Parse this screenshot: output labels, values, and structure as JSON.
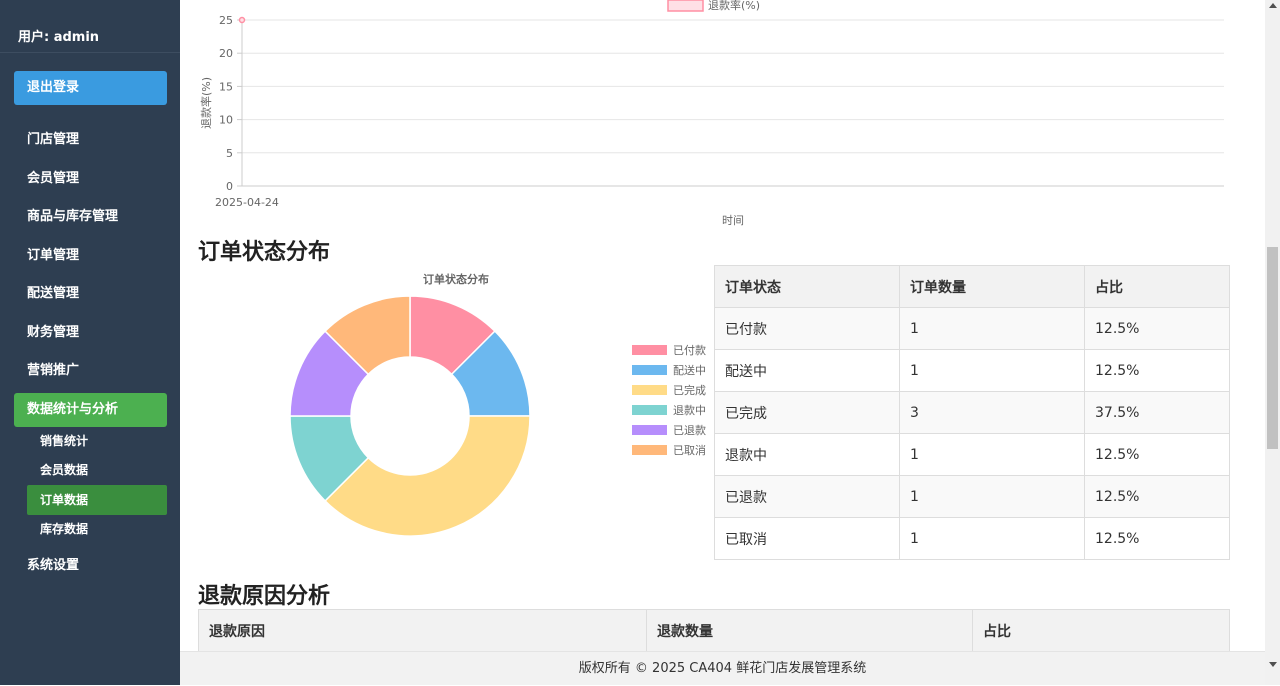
{
  "sidebar": {
    "user_label": "用户: admin",
    "logout_label": "退出登录",
    "items": [
      {
        "label": "门店管理"
      },
      {
        "label": "会员管理"
      },
      {
        "label": "商品与库存管理"
      },
      {
        "label": "订单管理"
      },
      {
        "label": "配送管理"
      },
      {
        "label": "财务管理"
      },
      {
        "label": "营销推广"
      },
      {
        "label": "数据统计与分析"
      },
      {
        "label": "系统设置"
      }
    ],
    "active_item": "数据统计与分析",
    "sub_items": [
      {
        "label": "销售统计"
      },
      {
        "label": "会员数据"
      },
      {
        "label": "订单数据"
      },
      {
        "label": "库存数据"
      }
    ],
    "active_sub_item": "订单数据",
    "colors": {
      "background": "#2e3e51",
      "logout": "#3a9be0",
      "active": "#4cb050",
      "active_sub": "#3a8e3e"
    }
  },
  "chart_data": [
    {
      "type": "line",
      "legend": "退款率(%)",
      "series": [
        {
          "name": "退款率(%)",
          "x": [
            "2025-04-24"
          ],
          "values": [
            25
          ]
        }
      ],
      "xlabel": "时间",
      "ylabel": "退款率(%)",
      "ylim": [
        0,
        25
      ],
      "yticks": [
        0,
        5,
        10,
        15,
        20,
        25
      ],
      "color": "#ff8fa3",
      "grid": true,
      "legend_position": "top"
    },
    {
      "type": "pie",
      "title": "订单状态分布",
      "categories": [
        "已付款",
        "配送中",
        "已完成",
        "退款中",
        "已退款",
        "已取消"
      ],
      "values": [
        1,
        1,
        3,
        1,
        1,
        1
      ],
      "colors": [
        "#ff8fa3",
        "#6cb8ef",
        "#ffdb87",
        "#7ed3d1",
        "#b68efc",
        "#ffb87a"
      ],
      "legend_position": "right"
    }
  ],
  "order_status_section": {
    "title": "订单状态分布",
    "headers": [
      "订单状态",
      "订单数量",
      "占比"
    ],
    "rows": [
      [
        "已付款",
        "1",
        "12.5%"
      ],
      [
        "配送中",
        "1",
        "12.5%"
      ],
      [
        "已完成",
        "3",
        "37.5%"
      ],
      [
        "退款中",
        "1",
        "12.5%"
      ],
      [
        "已退款",
        "1",
        "12.5%"
      ],
      [
        "已取消",
        "1",
        "12.5%"
      ]
    ]
  },
  "refund_reason_section": {
    "title": "退款原因分析",
    "headers": [
      "退款原因",
      "退款数量",
      "占比"
    ]
  },
  "footer": {
    "text": "版权所有 © 2025 CA404 鲜花门店发展管理系统"
  }
}
